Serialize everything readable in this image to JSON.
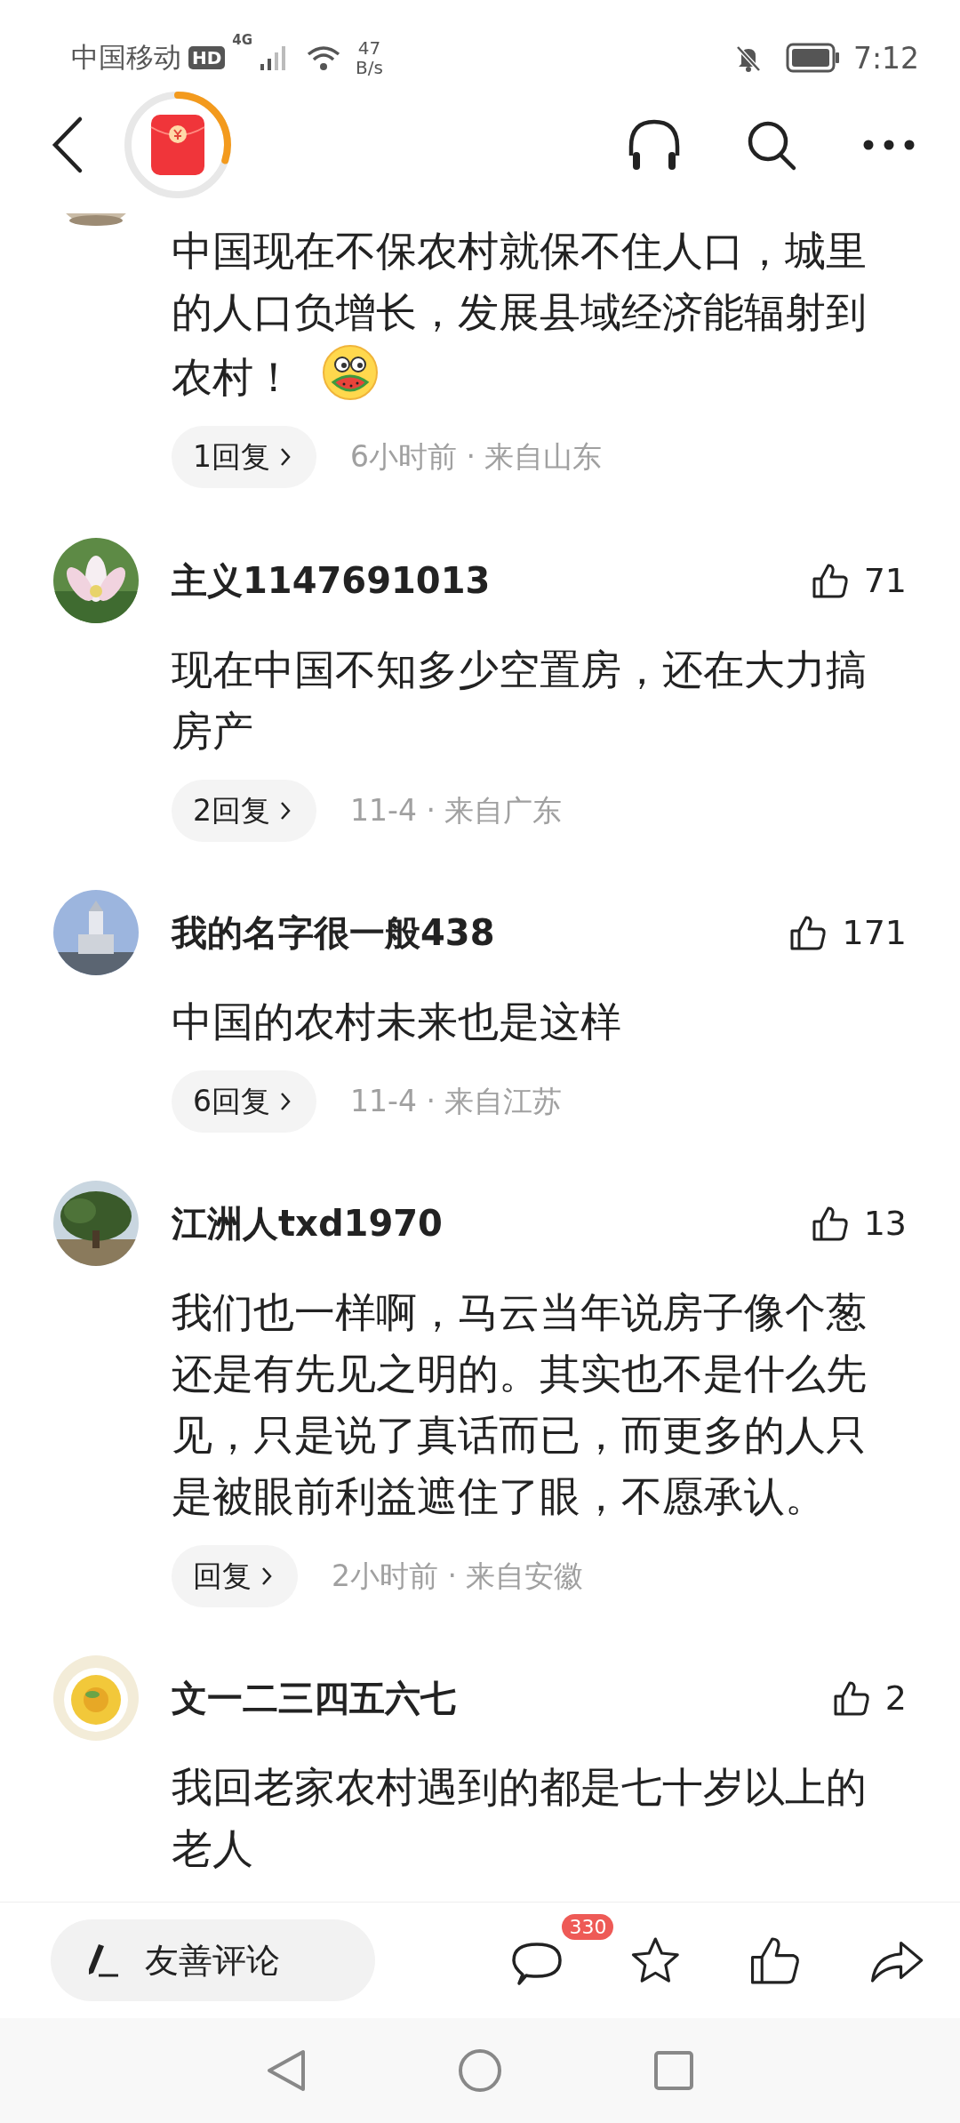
{
  "status_bar": {
    "carrier": "中国移动",
    "network_badge": "HD",
    "network_type": "4G",
    "speed_value": "47",
    "speed_unit": "B/s",
    "time": "7:12"
  },
  "header": {
    "reward": {
      "level": 0.3
    }
  },
  "comments": [
    {
      "kind": "partial",
      "text": "中国现在不保农村就保不住人口，城里的人口负增长，发展县域经济能辐射到农村！",
      "sticker": true,
      "reply_label": "1回复",
      "meta": "6小时前 · 来自山东"
    },
    {
      "kind": "full",
      "name": "主义1147691013",
      "likes": "71",
      "text": "现在中国不知多少空置房，还在大力搞房产",
      "reply_label": "2回复",
      "meta": "11-4 · 来自广东"
    },
    {
      "kind": "full",
      "name": "我的名字很一般438",
      "likes": "171",
      "text": "中国的农村未来也是这样",
      "reply_label": "6回复",
      "meta": "11-4 · 来自江苏"
    },
    {
      "kind": "full",
      "name": "江洲人txd1970",
      "likes": "13",
      "text": "我们也一样啊，马云当年说房子像个葱还是有先见之明的。其实也不是什么先见，只是说了真话而已，而更多的人只是被眼前利益遮住了眼，不愿承认。",
      "reply_label": "回复",
      "meta": "2小时前 · 来自安徽"
    },
    {
      "kind": "full",
      "name": "文一二三四五六七",
      "likes": "2",
      "text": "我回老家农村遇到的都是七十岁以上的老人"
    }
  ],
  "bottom_bar": {
    "compose_label": "友善评论",
    "comment_count": "330"
  }
}
